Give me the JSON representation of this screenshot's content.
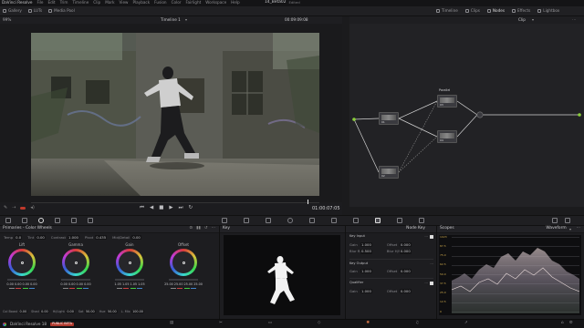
{
  "menu": {
    "items": [
      "DaVinci Resolve",
      "File",
      "Edit",
      "Trim",
      "Timeline",
      "Clip",
      "Mark",
      "View",
      "Playback",
      "Fusion",
      "Color",
      "Fairlight",
      "Workspace",
      "Help"
    ]
  },
  "project": {
    "name": "14_Beta02",
    "status": "Edited"
  },
  "toolbar": {
    "left": [
      "Gallery",
      "LUTs",
      "Media Pool"
    ],
    "right": [
      "Timeline",
      "Clips",
      "Nodes",
      "Effects",
      "Lightbox"
    ]
  },
  "viewer": {
    "zoom": "99%",
    "timeline_name": "Timeline 1",
    "timecode_top": "00:09:09:08",
    "timecode": "01:00:07:05"
  },
  "nodes": {
    "mode": "Clip",
    "labels": {
      "n1": "01",
      "n2": "02",
      "n3": "03",
      "n4": "04",
      "parallel": "Parallel"
    }
  },
  "primaries": {
    "title": "Primaries - Color Wheels",
    "top_params": [
      {
        "label": "Temp",
        "value": "0.0"
      },
      {
        "label": "Tint",
        "value": "0.00"
      },
      {
        "label": "Contrast",
        "value": "1.000"
      },
      {
        "label": "Pivot",
        "value": "0.435"
      },
      {
        "label": "Mid/Detail",
        "value": "0.00"
      }
    ],
    "wheels": [
      {
        "name": "Lift",
        "values": [
          "0.00",
          "0.00",
          "0.00",
          "0.00"
        ]
      },
      {
        "name": "Gamma",
        "values": [
          "0.00",
          "0.00",
          "0.00",
          "0.00"
        ]
      },
      {
        "name": "Gain",
        "values": [
          "1.05",
          "1.05",
          "1.05",
          "1.05"
        ]
      },
      {
        "name": "Offset",
        "values": [
          "25.00",
          "25.00",
          "25.00",
          "25.00"
        ]
      }
    ],
    "bottom_params": [
      {
        "label": "Col Boost",
        "value": "0.00"
      },
      {
        "label": "Shad",
        "value": "0.00"
      },
      {
        "label": "Hi/Light",
        "value": "0.00"
      },
      {
        "label": "Sat",
        "value": "50.00"
      },
      {
        "label": "Hue",
        "value": "50.00"
      },
      {
        "label": "L. Mix",
        "value": "100.00"
      }
    ]
  },
  "key": {
    "title": "Key"
  },
  "node_key": {
    "title": "Node Key",
    "key_input": "Key Input",
    "key_output": "Key Output",
    "qualifier": "Qualifier",
    "gain_label": "Gain",
    "gain_value": "1.000",
    "offset_label": "Offset",
    "offset_value": "0.000",
    "blur_r_label": "Blur R.",
    "blur_r_value": "0.500",
    "blur_hv_label": "Blur H/V",
    "blur_hv_value": "0.000"
  },
  "scopes": {
    "title": "Scopes",
    "mode": "Waveform",
    "ticks": [
      "1023",
      "87.5",
      "75.0",
      "62.5",
      "50.0",
      "37.5",
      "25.0",
      "12.5",
      "0"
    ]
  },
  "statusbar": {
    "app": "DaVinci Resolve 18",
    "badge": "PUBLIC BETA"
  },
  "colors": {
    "accent": "#d4653a",
    "node_green": "#8bcf3a",
    "link": "#c8c8c8"
  }
}
